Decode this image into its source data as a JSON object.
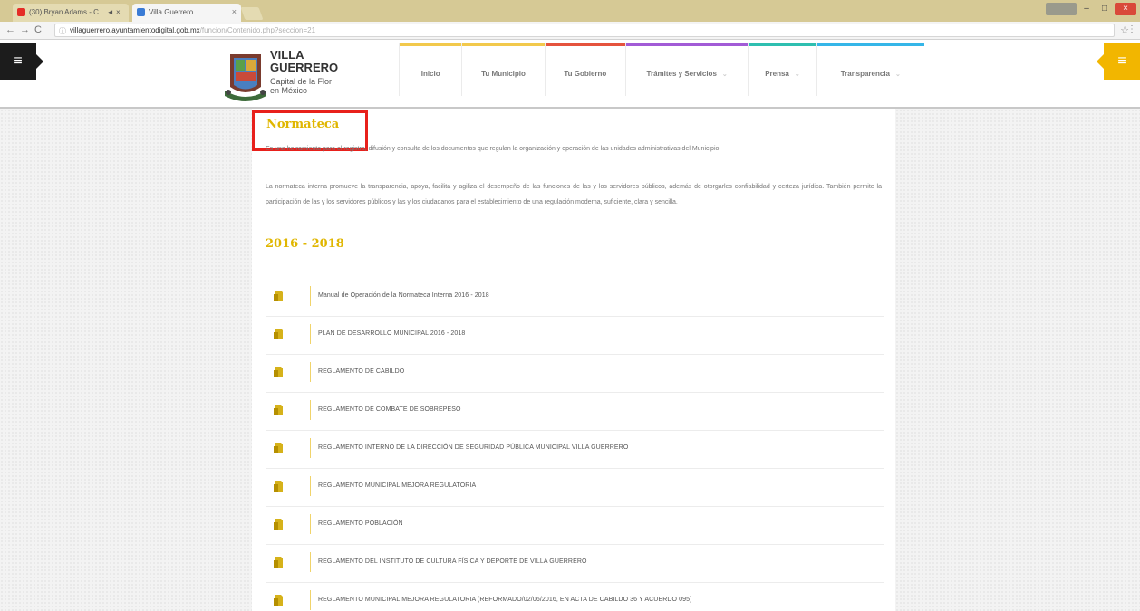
{
  "browser": {
    "tabs": [
      {
        "label": "(30) Bryan Adams - C... ◄ ×",
        "favicon_color": "#e52d27"
      },
      {
        "label": "Villa Guerrero",
        "favicon_color": "#3a7bd5"
      }
    ],
    "url_domain": "villaguerrero.ayuntamientodigital.gob.mx",
    "url_path": "/funcion/Contenido.php?seccion=21"
  },
  "header": {
    "logo_title_line1": "VILLA",
    "logo_title_line2": "GUERRERO",
    "logo_sub_line1": "Capital de la Flor",
    "logo_sub_line2": "en México",
    "nav": [
      {
        "label": "Inicio",
        "color": "#f2c94c",
        "has_caret": false
      },
      {
        "label": "Tu Municipio",
        "color": "#f2c94c",
        "has_caret": false
      },
      {
        "label": "Tu Gobierno",
        "color": "#e5533d",
        "has_caret": false
      },
      {
        "label": "Trámites y Servicios",
        "color": "#a25bd6",
        "has_caret": true
      },
      {
        "label": "Prensa",
        "color": "#2fbfb0",
        "has_caret": true
      },
      {
        "label": "Transparencia",
        "color": "#35b6e8",
        "has_caret": true
      }
    ]
  },
  "content": {
    "title": "Normateca",
    "paragraph1": "Es una herramienta para el registro, difusión y consulta de los documentos que regulan la organización y operación de las unidades administrativas del Municipio.",
    "paragraph2": "La normateca interna promueve la transparencia, apoya, facilita y agiliza el desempeño de las funciones de las y los servidores públicos, además de otorgarles confiabilidad y certeza jurídica. También permite la participación de las y los servidores públicos y las y los ciudadanos para el establecimiento de una regulación moderna, suficiente, clara y sencilla.",
    "period": "2016 - 2018",
    "documents": [
      "Manual de Operación de la Normateca Interna 2016 - 2018",
      "PLAN DE DESARROLLO MUNICIPAL 2016 - 2018",
      "REGLAMENTO DE CABILDO",
      "REGLAMENTO DE COMBATE DE SOBREPESO",
      "REGLAMENTO INTERNO DE LA DIRECCIÓN DE SEGURIDAD PÚBLICA MUNICIPAL VILLA GUERRERO",
      "REGLAMENTO MUNICIPAL MEJORA REGULATORIA",
      "REGLAMENTO POBLACIÓN",
      "REGLAMENTO DEL INSTITUTO DE CULTURA FÍSICA Y DEPORTE DE VILLA GUERRERO",
      "REGLAMENTO MUNICIPAL MEJORA REGULATORIA (REFORMADO/02/06/2016, EN ACTA DE CABILDO 36 Y ACUERDO 095)"
    ]
  },
  "colors": {
    "accent_gold": "#e0b600",
    "highlight_red": "#e8201b",
    "menu_yellow": "#f2b600"
  },
  "icons": [
    "hamburger-menu-icon",
    "pdf-document-icon",
    "star-icon",
    "info-icon"
  ]
}
